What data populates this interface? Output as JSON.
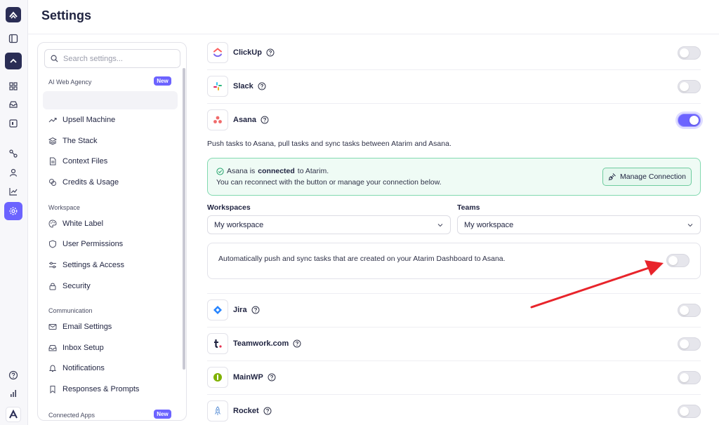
{
  "page": {
    "title": "Settings"
  },
  "rail": {
    "items": [
      {
        "name": "brand-logo-icon"
      },
      {
        "name": "sidebar-toggle-icon"
      },
      {
        "name": "workspace-logo-icon"
      },
      {
        "name": "grid-icon"
      },
      {
        "name": "inbox-icon"
      },
      {
        "name": "calendar-icon"
      },
      {
        "name": "flow-icon"
      },
      {
        "name": "user-icon"
      },
      {
        "name": "chart-icon"
      },
      {
        "name": "settings-icon"
      },
      {
        "name": "help-icon"
      },
      {
        "name": "stats-icon"
      },
      {
        "name": "atarim-logo-icon"
      }
    ]
  },
  "sidebar": {
    "search_placeholder": "Search settings...",
    "sections": {
      "ai_web_agency": "AI Web Agency",
      "workspace": "Workspace",
      "communication": "Communication",
      "connected_apps": "Connected Apps"
    },
    "badge_new": "New",
    "items": {
      "upsell_machine": "Upsell Machine",
      "the_stack": "The Stack",
      "context_files": "Context Files",
      "credits_usage": "Credits & Usage",
      "white_label": "White Label",
      "user_permissions": "User Permissions",
      "settings_access": "Settings & Access",
      "security": "Security",
      "email_settings": "Email Settings",
      "inbox_setup": "Inbox Setup",
      "notifications": "Notifications",
      "responses_prompts": "Responses & Prompts"
    }
  },
  "apps": {
    "clickup": {
      "name": "ClickUp",
      "enabled": false
    },
    "slack": {
      "name": "Slack",
      "enabled": false
    },
    "asana": {
      "name": "Asana",
      "enabled": true
    },
    "jira": {
      "name": "Jira",
      "enabled": false
    },
    "teamwork": {
      "name": "Teamwork.com",
      "enabled": false
    },
    "mainwp": {
      "name": "MainWP",
      "enabled": false
    },
    "rocket": {
      "name": "Rocket",
      "enabled": false
    }
  },
  "asana_panel": {
    "description": "Push tasks to Asana, pull tasks and sync tasks between Atarim and Asana.",
    "status_prefix": "Asana is",
    "status_bold": "connected",
    "status_suffix": "to Atarim.",
    "status_detail": "You can reconnect with the button or manage your connection below.",
    "manage_button": "Manage Connection",
    "workspaces_label": "Workspaces",
    "workspaces_value": "My workspace",
    "teams_label": "Teams",
    "teams_value": "My workspace",
    "auto_sync_text": "Automatically push and sync tasks that are created on your Atarim Dashboard to Asana.",
    "auto_sync_enabled": false
  },
  "colors": {
    "accent": "#6c63ff",
    "success_bg": "#effbf5",
    "success_border": "#82d9b0",
    "annotation_arrow": "#e8242b"
  }
}
